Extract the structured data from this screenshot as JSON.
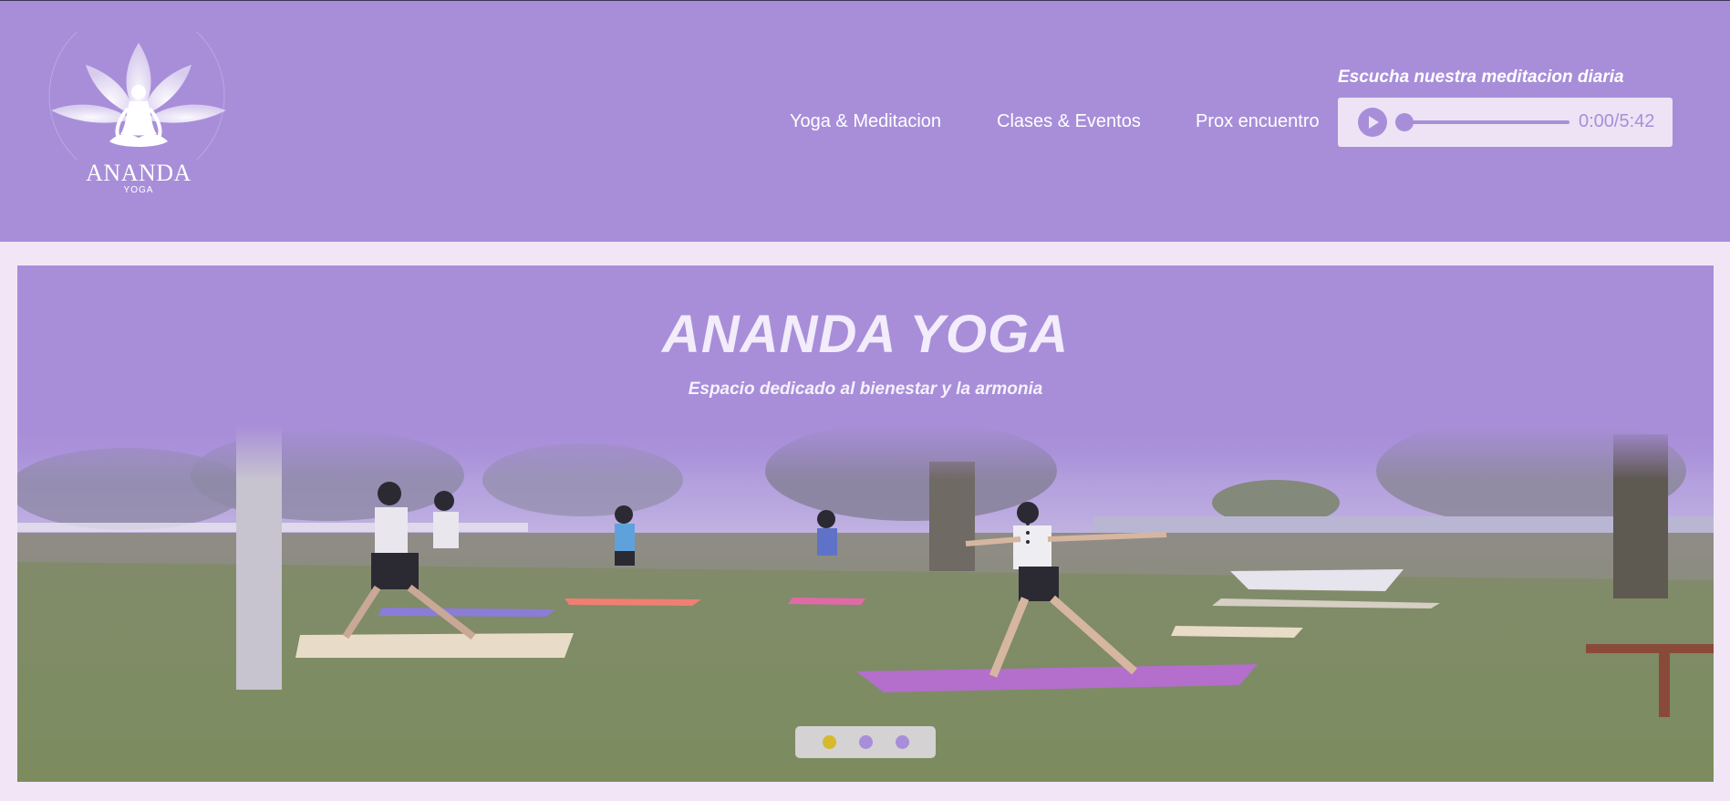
{
  "logo": {
    "name": "ANANDA",
    "subtitle": "YOGA"
  },
  "nav": {
    "items": [
      {
        "label": "Yoga & Meditacion"
      },
      {
        "label": "Clases & Eventos"
      },
      {
        "label": "Prox encuentro"
      }
    ]
  },
  "audio": {
    "caption": "Escucha nuestra meditacion diaria",
    "time": "0:00/5:42",
    "progress": 0,
    "play_icon": "play-icon"
  },
  "hero": {
    "title": "ANANDA YOGA",
    "subtitle": "Espacio dedicado al bienestar y la armonia",
    "slides": 3,
    "active_slide": 1
  },
  "colors": {
    "header_bg": "#a88ed9",
    "page_bg": "#f2e6f6",
    "active_dot": "#d6b92c",
    "inactive_dot": "#a88ed9"
  }
}
